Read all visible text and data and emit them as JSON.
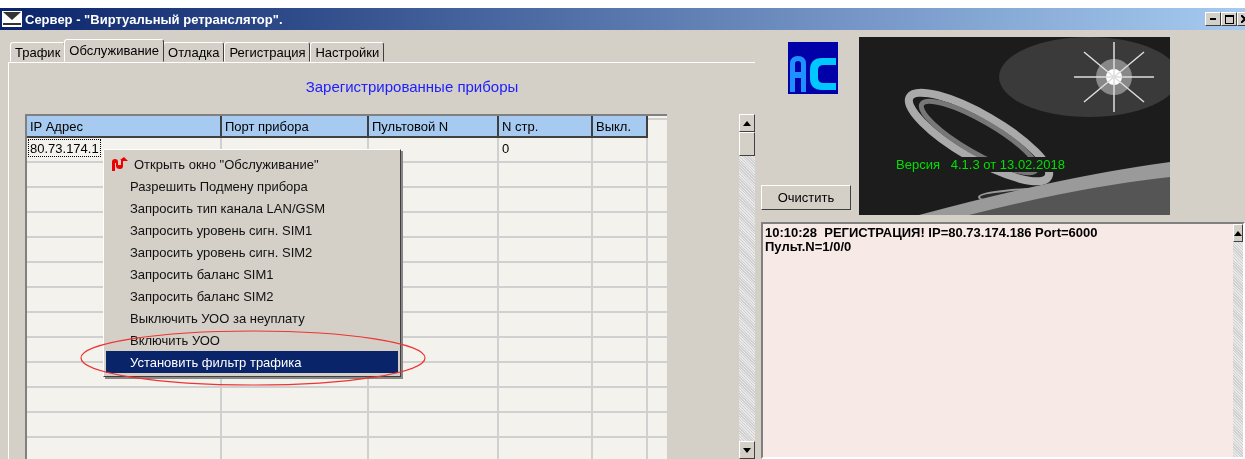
{
  "window": {
    "title": "Сервер - \"Виртуальный ретранслятор\"."
  },
  "tabs": [
    {
      "label": "Трафик",
      "selected": false
    },
    {
      "label": "Обслуживание",
      "selected": true
    },
    {
      "label": "Отладка",
      "selected": false
    },
    {
      "label": "Регистрация",
      "selected": false
    },
    {
      "label": "Настройки",
      "selected": false
    }
  ],
  "heading": "Зарегистрированные приборы",
  "table": {
    "columns": [
      "IP Адрес",
      "Порт прибора",
      "Пультовой N",
      "N стр.",
      "Выкл."
    ],
    "rows": [
      {
        "cells": [
          "80.73.174.1",
          "",
          "",
          "0",
          ""
        ],
        "focused": true
      }
    ]
  },
  "context_menu": {
    "items": [
      {
        "label": "Открыть окно \"Обслуживание\"",
        "icon": true,
        "selected": false
      },
      {
        "label": "Разрешить Подмену прибора",
        "icon": false,
        "selected": false
      },
      {
        "label": "Запросить тип канала LAN/GSM",
        "icon": false,
        "selected": false
      },
      {
        "label": "Запросить уровень сигн. SIM1",
        "icon": false,
        "selected": false
      },
      {
        "label": "Запросить уровень сигн. SIM2",
        "icon": false,
        "selected": false
      },
      {
        "label": "Запросить баланс SIM1",
        "icon": false,
        "selected": false
      },
      {
        "label": "Запросить баланс SIM2",
        "icon": false,
        "selected": false
      },
      {
        "label": "Выключить УОО за неуплату",
        "icon": false,
        "selected": false
      },
      {
        "label": "Включить УОО",
        "icon": false,
        "selected": false
      },
      {
        "label": "Установить фильтр трафика",
        "icon": false,
        "selected": true
      }
    ]
  },
  "version": "Версия   4.1.3 от 13.02.2018",
  "clear_button": "Очистить",
  "log": [
    "10:10:28  РЕГИСТРАЦИЯ! IP=80.73.174.186 Port=6000",
    "Пульт.N=1/0/0"
  ]
}
